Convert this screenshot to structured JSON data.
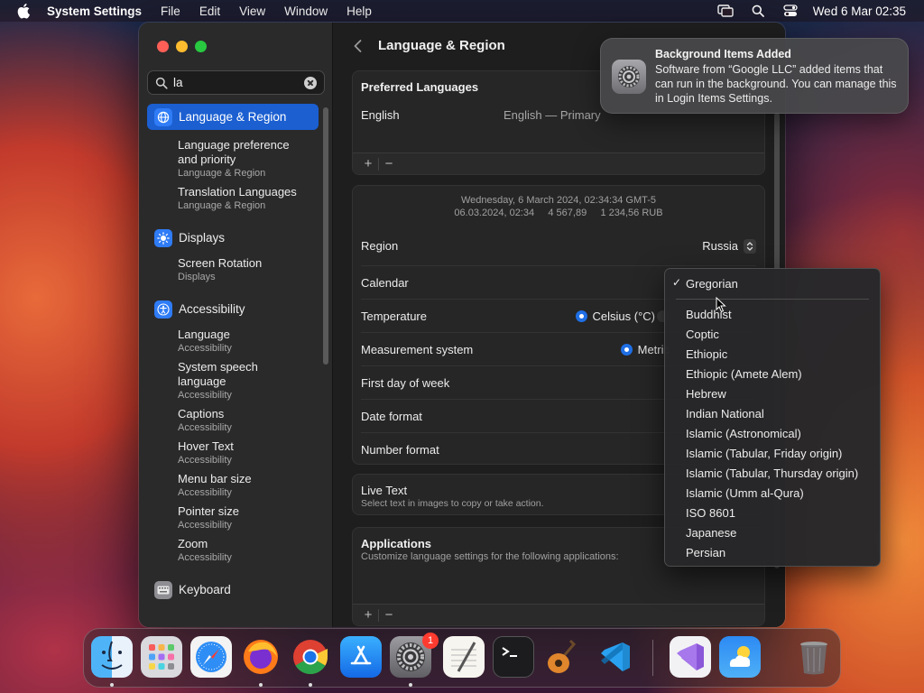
{
  "menubar": {
    "app_name": "System Settings",
    "menus": [
      "File",
      "Edit",
      "View",
      "Window",
      "Help"
    ],
    "clock": "Wed 6 Mar  02:35"
  },
  "sidebar": {
    "search_value": "la",
    "sections": [
      {
        "label": "Language & Region",
        "icon": "globe-icon",
        "selected": true,
        "results": [
          {
            "title": "Language preference and priority",
            "category": "Language & Region"
          },
          {
            "title": "Translation Languages",
            "category": "Language & Region"
          }
        ]
      },
      {
        "label": "Displays",
        "icon": "sun-icon",
        "results": [
          {
            "title": "Screen Rotation",
            "category": "Displays"
          }
        ]
      },
      {
        "label": "Accessibility",
        "icon": "accessibility-icon",
        "results": [
          {
            "title": "Language",
            "category": "Accessibility"
          },
          {
            "title": "System speech language",
            "category": "Accessibility"
          },
          {
            "title": "Captions",
            "category": "Accessibility"
          },
          {
            "title": "Hover Text",
            "category": "Accessibility"
          },
          {
            "title": "Menu bar size",
            "category": "Accessibility"
          },
          {
            "title": "Pointer size",
            "category": "Accessibility"
          },
          {
            "title": "Zoom",
            "category": "Accessibility"
          }
        ]
      },
      {
        "label": "Keyboard",
        "icon": "keyboard-icon",
        "results": []
      }
    ]
  },
  "main": {
    "title": "Language & Region",
    "preferred": {
      "heading": "Preferred Languages",
      "language": "English",
      "language_value": "English — Primary",
      "add": "+",
      "remove": "−"
    },
    "format_preview": {
      "line1": "Wednesday, 6 March 2024, 02:34:34 GMT-5",
      "line2": "06.03.2024, 02:34     4 567,89     1 234,56 RUB"
    },
    "rows": {
      "region_label": "Region",
      "region_value": "Russia",
      "calendar_label": "Calendar",
      "temperature_label": "Temperature",
      "temperature_value": "Celsius (°C)",
      "measurement_label": "Measurement system",
      "measurement_value": "Metric",
      "first_day_label": "First day of week",
      "date_format_label": "Date format",
      "number_format_label": "Number format"
    },
    "live_text": {
      "title": "Live Text",
      "subtitle": "Select text in images to copy or take action."
    },
    "applications": {
      "title": "Applications",
      "subtitle": "Customize language settings for the following applications:",
      "add": "+",
      "remove": "−"
    }
  },
  "calendar_menu": {
    "selected": "Gregorian",
    "options": [
      "Buddhist",
      "Coptic",
      "Ethiopic",
      "Ethiopic (Amete Alem)",
      "Hebrew",
      "Indian National",
      "Islamic (Astronomical)",
      "Islamic (Tabular, Friday origin)",
      "Islamic (Tabular, Thursday origin)",
      "Islamic (Umm al-Qura)",
      "ISO 8601",
      "Japanese",
      "Persian"
    ]
  },
  "notification": {
    "title": "Background Items Added",
    "body": "Software from “Google LLC” added items that can run in the background. You can manage this in Login Items Settings."
  },
  "dock": {
    "apps": [
      "Finder",
      "Launchpad",
      "Safari",
      "Firefox",
      "Chrome",
      "App Store",
      "System Settings",
      "TextEdit",
      "Terminal",
      "GarageBand",
      "Visual Studio Code",
      "Visual Studio",
      "Weather",
      "Trash"
    ],
    "system_settings_badge": "1"
  },
  "colors": {
    "accent": "#1b5fd1",
    "badge": "#ff3b30"
  }
}
